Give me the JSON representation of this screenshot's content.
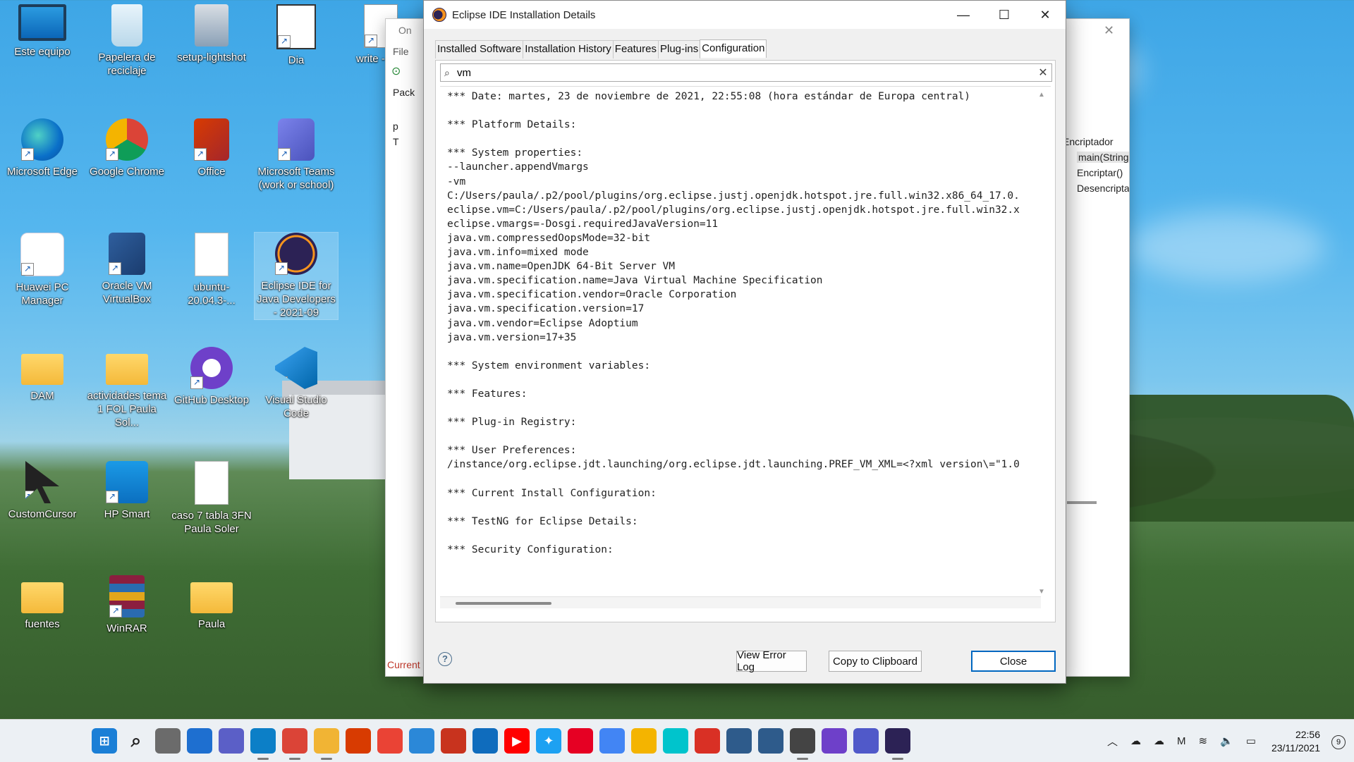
{
  "desktop": {
    "icons": [
      {
        "label": "Este equipo",
        "icon": "monitor-icon",
        "shortcut": false
      },
      {
        "label": "Papelera de reciclaje",
        "icon": "recycle-bin-icon",
        "shortcut": false
      },
      {
        "label": "setup-lightshot",
        "icon": "installer-icon",
        "shortcut": false
      },
      {
        "label": "Dia",
        "icon": "dia-icon",
        "shortcut": true
      },
      {
        "label": "write - dire",
        "icon": "document-icon",
        "shortcut": true
      },
      {
        "label": "Microsoft Edge",
        "icon": "edge-icon",
        "shortcut": true
      },
      {
        "label": "Google Chrome",
        "icon": "chrome-icon",
        "shortcut": true
      },
      {
        "label": "Office",
        "icon": "office-icon",
        "shortcut": true
      },
      {
        "label": "Microsoft Teams (work or school)",
        "icon": "teams-icon",
        "shortcut": true
      },
      {
        "label": "Huawei PC Manager",
        "icon": "huawei-icon",
        "shortcut": true
      },
      {
        "label": "Oracle VM VirtualBox",
        "icon": "virtualbox-icon",
        "shortcut": true
      },
      {
        "label": "ubuntu-20.04.3-...",
        "icon": "disc-image-icon",
        "shortcut": false
      },
      {
        "label": "Eclipse IDE for Java Developers - 2021-09",
        "icon": "eclipse-icon",
        "shortcut": true
      },
      {
        "label": "DAM",
        "icon": "folder-icon",
        "shortcut": false
      },
      {
        "label": "actividades tema 1 FOL Paula Sol...",
        "icon": "folder-icon",
        "shortcut": false
      },
      {
        "label": "GitHub Desktop",
        "icon": "github-icon",
        "shortcut": true
      },
      {
        "label": "Visual Studio Code",
        "icon": "vscode-icon",
        "shortcut": true
      },
      {
        "label": "CustomCursor",
        "icon": "cursor-icon",
        "shortcut": true
      },
      {
        "label": "HP Smart",
        "icon": "hp-smart-icon",
        "shortcut": true
      },
      {
        "label": "caso 7 tabla 3FN Paula Soler",
        "icon": "edge-document-icon",
        "shortcut": false
      },
      {
        "label": "fuentes",
        "icon": "folder-icon",
        "shortcut": false
      },
      {
        "label": "WinRAR",
        "icon": "winrar-icon",
        "shortcut": true
      },
      {
        "label": "Paula",
        "icon": "folder-icon",
        "shortcut": false
      }
    ]
  },
  "background_window": {
    "title_fragment": "On",
    "menu_file": "File",
    "package_tab": "Pack",
    "tree_items": [
      "p",
      "T"
    ],
    "outline_title": "Encriptador",
    "outline_items": [
      "main(String",
      "Encriptar()",
      "Desencripta"
    ],
    "status": "Current"
  },
  "dialog": {
    "title": "Eclipse IDE Installation Details",
    "tabs": [
      {
        "label": "Installed Software",
        "active": false
      },
      {
        "label": "Installation History",
        "active": false
      },
      {
        "label": "Features",
        "active": false
      },
      {
        "label": "Plug-ins",
        "active": false
      },
      {
        "label": "Configuration",
        "active": true
      }
    ],
    "filter_value": "vm",
    "config_lines": [
      "*** Date: martes, 23 de noviembre de 2021, 22:55:08 (hora estándar de Europa central)",
      "",
      "*** Platform Details:",
      "",
      "*** System properties:",
      "--launcher.appendVmargs",
      "-vm",
      "C:/Users/paula/.p2/pool/plugins/org.eclipse.justj.openjdk.hotspot.jre.full.win32.x86_64_17.0.",
      "eclipse.vm=C:/Users/paula/.p2/pool/plugins/org.eclipse.justj.openjdk.hotspot.jre.full.win32.x",
      "eclipse.vmargs=-Dosgi.requiredJavaVersion=11",
      "java.vm.compressedOopsMode=32-bit",
      "java.vm.info=mixed mode",
      "java.vm.name=OpenJDK 64-Bit Server VM",
      "java.vm.specification.name=Java Virtual Machine Specification",
      "java.vm.specification.vendor=Oracle Corporation",
      "java.vm.specification.version=17",
      "java.vm.vendor=Eclipse Adoptium",
      "java.vm.version=17+35",
      "",
      "*** System environment variables:",
      "",
      "*** Features:",
      "",
      "*** Plug-in Registry:",
      "",
      "*** User Preferences:",
      "/instance/org.eclipse.jdt.launching/org.eclipse.jdt.launching.PREF_VM_XML=<?xml version\\=\"1.0",
      "",
      "*** Current Install Configuration:",
      "",
      "*** TestNG for Eclipse Details:",
      "",
      "*** Security Configuration:"
    ],
    "buttons": {
      "view_error_log": "View Error Log",
      "copy": "Copy to Clipboard",
      "close": "Close"
    },
    "help_glyph": "?"
  },
  "taskbar": {
    "apps": [
      {
        "name": "start-icon"
      },
      {
        "name": "search-icon"
      },
      {
        "name": "task-view-icon"
      },
      {
        "name": "widgets-icon"
      },
      {
        "name": "chat-icon"
      },
      {
        "name": "edge-icon"
      },
      {
        "name": "chrome-icon"
      },
      {
        "name": "file-explorer-icon"
      },
      {
        "name": "office-icon"
      },
      {
        "name": "gmail-icon"
      },
      {
        "name": "store-icon"
      },
      {
        "name": "office-alt-icon"
      },
      {
        "name": "mail-icon"
      },
      {
        "name": "youtube-icon"
      },
      {
        "name": "twitter-icon"
      },
      {
        "name": "pinterest-icon"
      },
      {
        "name": "docs-icon"
      },
      {
        "name": "slides-icon"
      },
      {
        "name": "canva-icon"
      },
      {
        "name": "gmail-alt-icon"
      },
      {
        "name": "mysql-workbench-icon"
      },
      {
        "name": "mysql-workbench-alt-icon"
      },
      {
        "name": "dia-icon"
      },
      {
        "name": "github-icon"
      },
      {
        "name": "teams-icon"
      },
      {
        "name": "eclipse-icon"
      }
    ],
    "time": "22:56",
    "date": "23/11/2021",
    "notifications": "9"
  }
}
